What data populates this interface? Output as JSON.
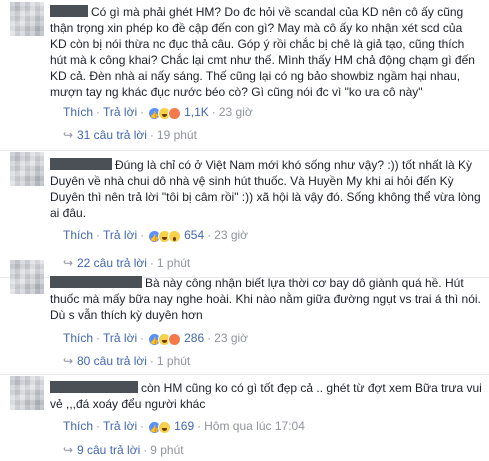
{
  "comments": [
    {
      "text": "Có gì mà phải ghét HM? Do đc hỏi về scandal của KD nên cô ấy cũng thận trọng xin phép ko đề cập đến con gì? May mà cô ấy ko nhận xét scd của KD còn bị nói thừa nc đục thả câu. Góp ý rồi chắc bị chê là giả tạo, cũng thích hút mà k công khai? Chắc lại cmt như thế. Mình thấy HM chả động chạm gì đến KD cả. Đèn nhà ai nấy sáng. Thế cũng lại có ng bảo showbiz ngầm hại nhau, mượn tay ng khác đục nước béo cò? Gì cũng nói đc vì \"ko ưa cô này\"",
      "like_label": "Thích",
      "reply_label": "Trả lời",
      "reactions": [
        "like-icon",
        "haha-icon",
        "angry-icon"
      ],
      "reaction_count": "1,1K",
      "time": "23 giờ",
      "replies_count_text": "31 câu trả lời",
      "replies_time": "19 phút"
    },
    {
      "text": "Đúng là chỉ có ở Việt Nam mới khó sống như vậy? :)) tốt nhất là Kỳ Duyên về nhà chui dô nhà vệ sinh hút thuốc. Và Huyền My khi ai hỏi đến Kỳ Duyên thì nên trả lời \"tôi bị câm rồi\" :)) xã hội là vậy đó. Sống không thể vừa lòng ai đâu.",
      "like_label": "Thích",
      "reply_label": "Trả lời",
      "reactions": [
        "like-icon",
        "haha-icon",
        "wow-icon"
      ],
      "reaction_count": "654",
      "time": "23 giờ",
      "replies_count_text": "22 câu trả lời",
      "replies_time": "1 phút"
    },
    {
      "text": "Bà này công nhận biết lựa thời cơ bay dô giành quá hề. Hút thuốc mà mấy bữa nay nghe hoài. Khi nào nằm giữa đường ngụt vs trai á thì nói. Dù s vẫn thích kỳ duyên hơn",
      "like_label": "Thích",
      "reply_label": "Trả lời",
      "reactions": [
        "like-icon",
        "haha-icon",
        "angry-icon"
      ],
      "reaction_count": "286",
      "time": "23 giờ",
      "replies_count_text": "80 câu trả lời",
      "replies_time": "1 phút"
    },
    {
      "text": "còn HM cũng ko có gì tốt đẹp cả .. ghét từ đợt xem Bữa trưa vui vẻ ,,,đá xoáy đểu người khác",
      "like_label": "Thích",
      "reply_label": "Trả lời",
      "reactions": [
        "like-icon",
        "haha-icon"
      ],
      "reaction_count": "169",
      "time": "Hôm qua lúc 17:04",
      "replies_count_text": "9 câu trả lời",
      "replies_time": "9 phút"
    }
  ],
  "colors": {
    "link": "#4267b2",
    "meta": "#90949c",
    "text": "#1d2129"
  }
}
